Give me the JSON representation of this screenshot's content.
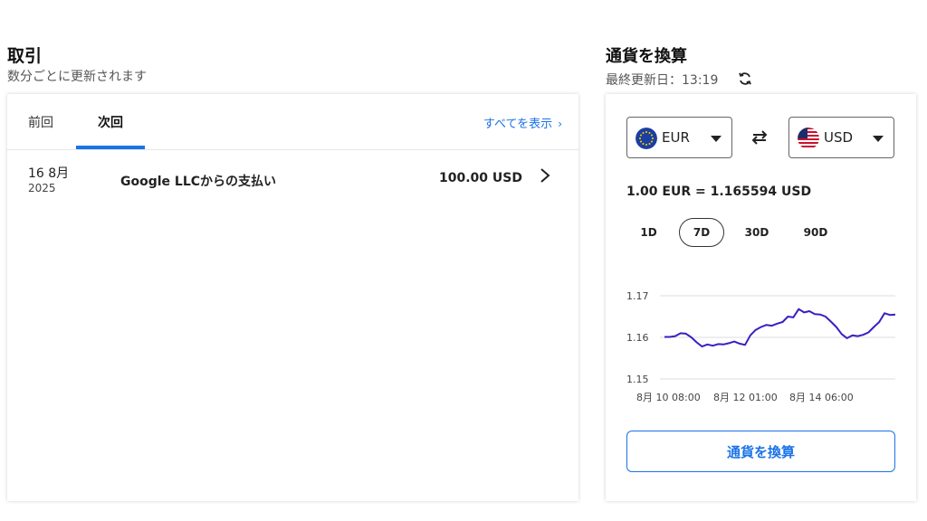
{
  "transactions": {
    "title": "取引",
    "subtitle": "数分ごとに更新されます",
    "tabs": [
      "前回",
      "次回"
    ],
    "active_tab": "次回",
    "view_all_label": "すべてを表示",
    "rows": [
      {
        "day_month": "16 8月",
        "year": "2025",
        "description": "Google LLCからの支払い",
        "amount": "100.00 USD"
      }
    ]
  },
  "converter": {
    "title": "通貨を換算",
    "updated": "最終更新日：13:19",
    "from": {
      "code": "EUR",
      "icon": "eu-flag-icon"
    },
    "to": {
      "code": "USD",
      "icon": "us-flag-icon"
    },
    "rate": "1.00 EUR = 1.165594 USD",
    "ranges": [
      "1D",
      "7D",
      "30D",
      "90D"
    ],
    "selected_range": "7D",
    "convert_label": "通貨を換算",
    "accent_color": "#1a73e8",
    "line_color": "#3a1fc1"
  },
  "chart_data": {
    "type": "line",
    "title": "",
    "xlabel": "",
    "ylabel": "",
    "ylim": [
      1.15,
      1.17
    ],
    "yticks": [
      "1.17",
      "1.16",
      "1.15"
    ],
    "xticks": [
      "8月 10 08:00",
      "8月 12 01:00",
      "8月 14 06:00"
    ],
    "grid": true,
    "series": [
      {
        "values": [
          1.1601,
          1.1601,
          1.1603,
          1.161,
          1.1609,
          1.16,
          1.1588,
          1.1578,
          1.1583,
          1.158,
          1.1584,
          1.1583,
          1.1586,
          1.159,
          1.1585,
          1.1582,
          1.1605,
          1.1618,
          1.1625,
          1.163,
          1.1628,
          1.1633,
          1.1637,
          1.165,
          1.1648,
          1.1668,
          1.166,
          1.1663,
          1.1656,
          1.1655,
          1.165,
          1.1638,
          1.1625,
          1.1608,
          1.1598,
          1.1605,
          1.1603,
          1.1606,
          1.1612,
          1.1625,
          1.1637,
          1.1658,
          1.1654,
          1.1655
        ]
      }
    ]
  }
}
